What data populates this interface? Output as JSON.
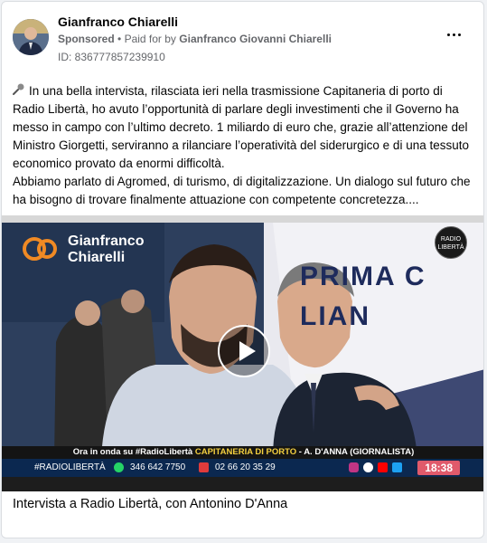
{
  "post": {
    "author": "Gianfranco Chiarelli",
    "sponsored_label": "Sponsored",
    "separator": "•",
    "paid_for_prefix": "Paid for by",
    "paid_for_name": "Gianfranco Giovanni Chiarelli",
    "ad_id": "ID: 836777857239910",
    "paragraph1": "In una bella intervista, rilasciata ieri nella trasmissione Capitaneria di porto di Radio Libertà, ho avuto l’opportunità di parlare degli investimenti che il Governo ha messo in campo con l’ultimo decreto. 1 miliardo di euro che, grazie all’attenzione del Ministro Giorgetti, serviranno a rilanciare l’operatività del siderurgico e di una tessuto economico provato da enormi difficoltà.",
    "paragraph2": "Abbiamo parlato di Agromed, di turismo, di digitalizzazione. Un dialogo sul futuro che ha bisogno di trovare finalmente attuazione con competente concretezza....",
    "caption": "Intervista a Radio Libertà, con Antonino D'Anna"
  },
  "video": {
    "logo_line1": "Gianfranco",
    "logo_line2": "Chiarelli",
    "radio_logo_line1": "RADIO",
    "radio_logo_line2": "LIBERTÀ",
    "poster_line1": "PRIMA C",
    "poster_line2": "LIAN",
    "ticker_prefix": "Ora in onda su #RadioLibertà ",
    "ticker_highlight": "CAPITANERIA DI PORTO",
    "ticker_suffix": " - A. D'ANNA  (GIORNALISTA)",
    "hashtag": "#RADIOLIBERTÀ",
    "phone1": "346 642 7750",
    "phone2": "02 66 20 35 29",
    "time": "18:38"
  },
  "icons": {
    "mic": "microphone-icon",
    "more": "more-options-icon",
    "play": "play-icon"
  }
}
